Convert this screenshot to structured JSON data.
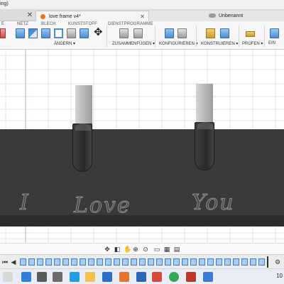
{
  "window": {
    "title_fragment": "ing)"
  },
  "tabs": [
    {
      "label": "love frame v4*",
      "active": true
    },
    {
      "label": "Unbenannt",
      "active": false
    }
  ],
  "ribbon": {
    "workspace_tabs": [
      "E",
      "NETZ",
      "BLECH",
      "KUNSTSTOFF",
      "DIENSTPROGRAMME"
    ],
    "groups": [
      {
        "label": "ÄNDERN ▾"
      },
      {
        "label": "ZUSAMMENFÜGEN ▾"
      },
      {
        "label": "KONFIGURIEREN ▾"
      },
      {
        "label": "KONSTRUIEREN ▾"
      },
      {
        "label": "PRÜFEN ▾"
      },
      {
        "label": "EIN"
      }
    ]
  },
  "model": {
    "engraving": [
      "I",
      "Love",
      "You"
    ]
  },
  "taskbar": {
    "clock": "10"
  },
  "colors": {
    "accent": "#4d8cd0",
    "model": "#3a3a3a",
    "tab_dot": "#e8732c"
  }
}
